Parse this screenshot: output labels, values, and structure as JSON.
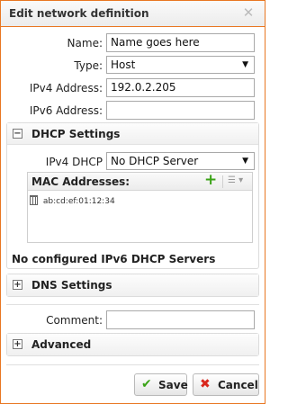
{
  "dialog": {
    "title": "Edit network definition",
    "close_glyph": "✕"
  },
  "form": {
    "name_label": "Name:",
    "name_value": "Name goes here",
    "type_label": "Type:",
    "type_value": "Host",
    "ipv4_label": "IPv4 Address:",
    "ipv4_value": "192.0.2.205",
    "ipv6_label": "IPv6 Address:",
    "ipv6_value": ""
  },
  "dhcp": {
    "title": "DHCP Settings",
    "toggle_glyph": "−",
    "ipv4_dhcp_label": "IPv4 DHCP",
    "ipv4_dhcp_value": "No DHCP Server",
    "mac_title": "MAC Addresses:",
    "add_glyph": "+",
    "mac_entries": [
      "ab:cd:ef:01:12:34"
    ],
    "ipv6_notice": "No configured IPv6 DHCP Servers"
  },
  "dns": {
    "title": "DNS Settings",
    "toggle_glyph": "+"
  },
  "comment": {
    "label": "Comment:",
    "value": ""
  },
  "advanced": {
    "title": "Advanced",
    "toggle_glyph": "+"
  },
  "buttons": {
    "save_label": "Save",
    "cancel_label": "Cancel",
    "save_icon": "check-icon",
    "cancel_icon": "x-icon"
  },
  "colors": {
    "accent": "#e87722",
    "add_green": "#3aa316",
    "cancel_red": "#d9261c",
    "save_green": "#3aa316"
  }
}
